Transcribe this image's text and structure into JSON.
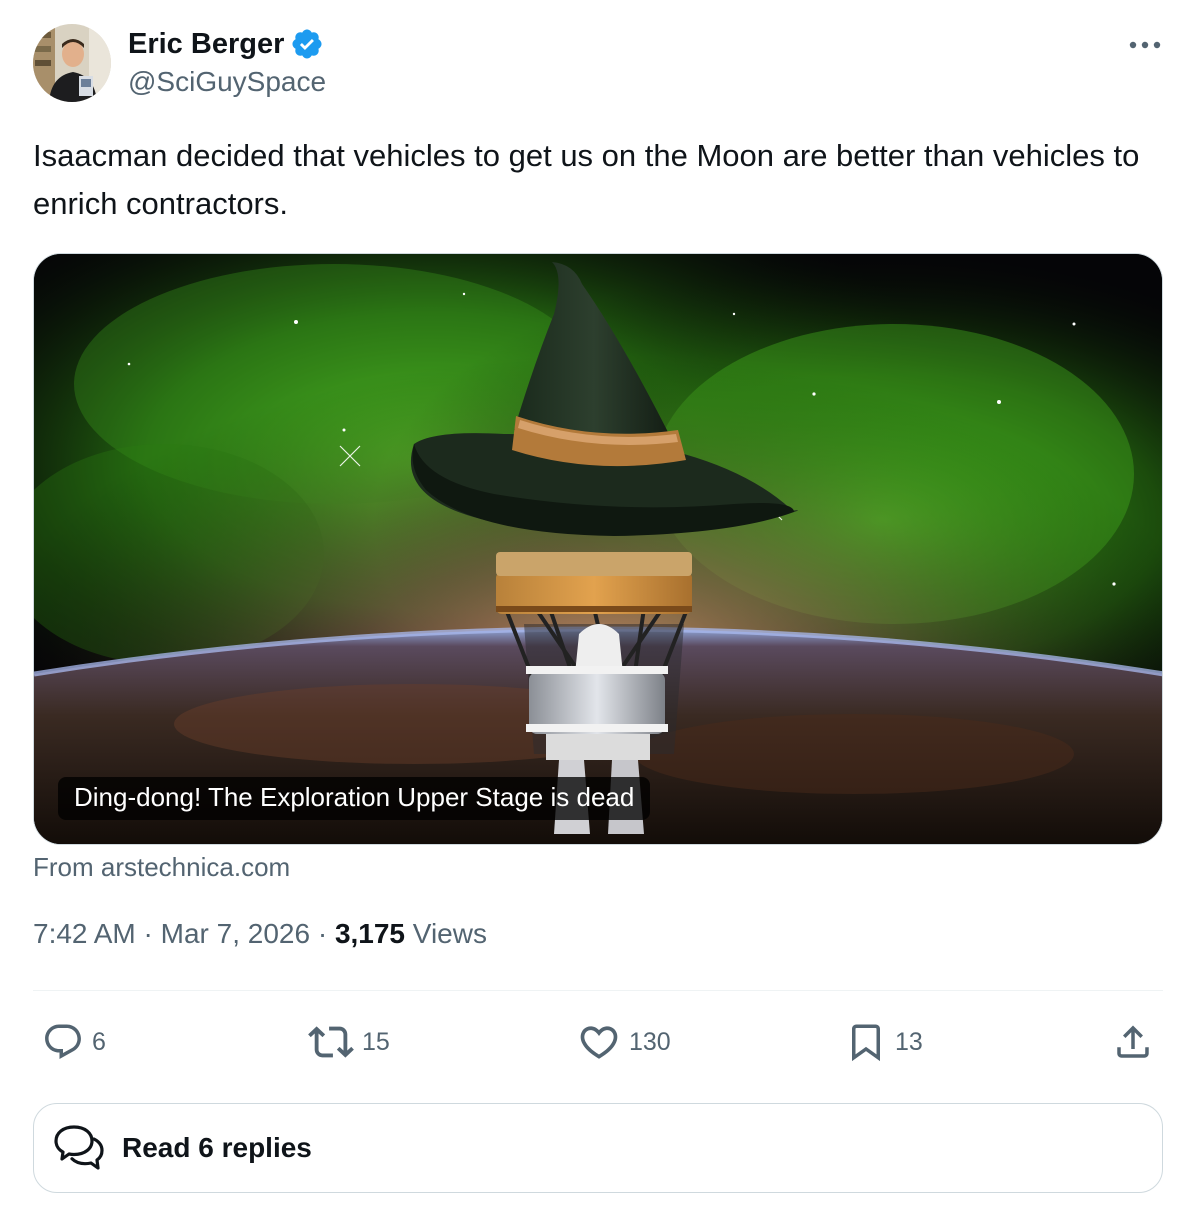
{
  "author": {
    "display_name": "Eric Berger",
    "handle": "@SciGuySpace",
    "verified": true
  },
  "tweet": {
    "text": "Isaacman decided that vehicles to get us on the Moon are better than vehicles to enrich contractors."
  },
  "media": {
    "caption": "Ding-dong! The Exploration Upper Stage is dead",
    "source": "From arstechnica.com"
  },
  "meta": {
    "time": "7:42 AM",
    "separator1": " · ",
    "date": "Mar 7, 2026",
    "separator2": " · ",
    "views_count": "3,175",
    "views_label": " Views"
  },
  "actions": {
    "replies": "6",
    "retweets": "15",
    "likes": "130",
    "bookmarks": "13"
  },
  "read_replies": {
    "label": "Read 6 replies"
  },
  "colors": {
    "text": "#0f1419",
    "secondary": "#536471",
    "verified": "#1d9bf0",
    "border": "#cfd9de"
  },
  "icons": [
    "verified-badge-icon",
    "more-icon",
    "reply-icon",
    "retweet-icon",
    "like-icon",
    "bookmark-icon",
    "share-icon",
    "chat-bubbles-icon"
  ]
}
